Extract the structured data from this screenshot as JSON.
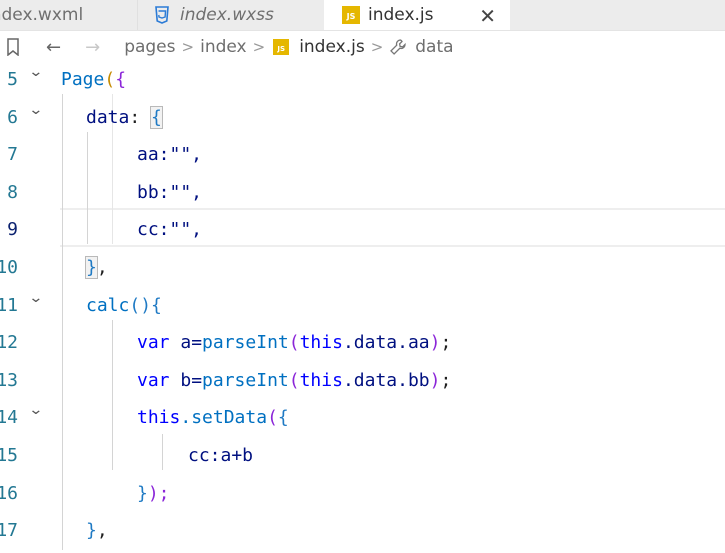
{
  "tabs": [
    {
      "label": "index.wxml",
      "icon": "xml-icon"
    },
    {
      "label": "index.wxss",
      "icon": "css3-icon"
    },
    {
      "label": "index.js",
      "icon": "js-badge-icon",
      "active": true
    }
  ],
  "tab_close_glyph": "✕",
  "js_badge_text": "JS",
  "breadcrumb": {
    "back_glyph": "←",
    "forward_glyph": "→",
    "sep": ">",
    "items": [
      "pages",
      "index",
      "index.js",
      "data"
    ]
  },
  "editor": {
    "current_line": "9",
    "lines": [
      {
        "num": "5"
      },
      {
        "num": "6"
      },
      {
        "num": "7"
      },
      {
        "num": "8"
      },
      {
        "num": "9"
      },
      {
        "num": "10"
      },
      {
        "num": "11"
      },
      {
        "num": "12"
      },
      {
        "num": "13"
      },
      {
        "num": "14"
      },
      {
        "num": "15"
      },
      {
        "num": "16"
      },
      {
        "num": "17"
      }
    ],
    "fold_glyph": "⌄",
    "tokens": {
      "page": "Page",
      "open_paren": "(",
      "open_brace": "{",
      "data_key": "data",
      "colon": ":",
      "aa_line": "aa:\"\",",
      "bb_line": "bb:\"\",",
      "cc_line": "cc:\"\",",
      "close_brace_comma_brace": "}",
      "comma": ",",
      "calc": "calc",
      "paren_pair": "()",
      "var": "var",
      "a_assign": "a=",
      "b_assign": "b=",
      "parseInt": "parseInt",
      "this": "this",
      "data_aa": ".data.aa",
      "data_bb": ".data.bb",
      "close_paren": ")",
      "semicolon": ";",
      "setData": ".setData",
      "cc_expr": "cc:a+b",
      "close_brace": "}",
      "close_paren_semi": ");"
    }
  },
  "colors": {
    "keyword": "#0000ff",
    "function": "#795e26",
    "variable": "#001080",
    "string": "#a31515",
    "line_number": "#237893",
    "js_badge": "#e5b700"
  }
}
